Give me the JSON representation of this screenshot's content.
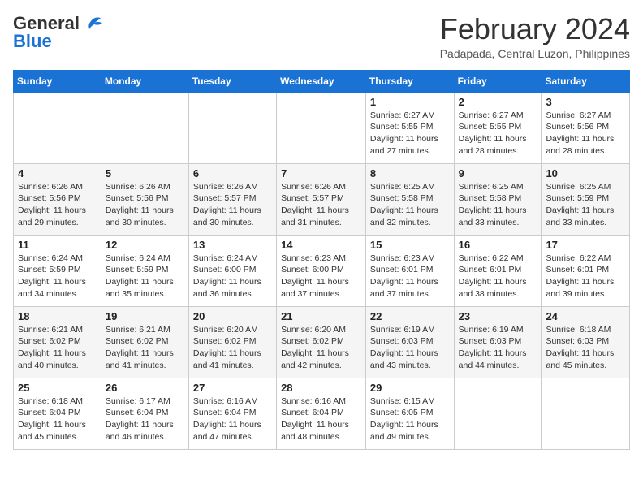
{
  "header": {
    "logo_general": "General",
    "logo_blue": "Blue",
    "month_year": "February 2024",
    "location": "Padapada, Central Luzon, Philippines"
  },
  "calendar": {
    "days_of_week": [
      "Sunday",
      "Monday",
      "Tuesday",
      "Wednesday",
      "Thursday",
      "Friday",
      "Saturday"
    ],
    "weeks": [
      [
        {
          "day": "",
          "info": ""
        },
        {
          "day": "",
          "info": ""
        },
        {
          "day": "",
          "info": ""
        },
        {
          "day": "",
          "info": ""
        },
        {
          "day": "1",
          "info": "Sunrise: 6:27 AM\nSunset: 5:55 PM\nDaylight: 11 hours and 27 minutes."
        },
        {
          "day": "2",
          "info": "Sunrise: 6:27 AM\nSunset: 5:55 PM\nDaylight: 11 hours and 28 minutes."
        },
        {
          "day": "3",
          "info": "Sunrise: 6:27 AM\nSunset: 5:56 PM\nDaylight: 11 hours and 28 minutes."
        }
      ],
      [
        {
          "day": "4",
          "info": "Sunrise: 6:26 AM\nSunset: 5:56 PM\nDaylight: 11 hours and 29 minutes."
        },
        {
          "day": "5",
          "info": "Sunrise: 6:26 AM\nSunset: 5:56 PM\nDaylight: 11 hours and 30 minutes."
        },
        {
          "day": "6",
          "info": "Sunrise: 6:26 AM\nSunset: 5:57 PM\nDaylight: 11 hours and 30 minutes."
        },
        {
          "day": "7",
          "info": "Sunrise: 6:26 AM\nSunset: 5:57 PM\nDaylight: 11 hours and 31 minutes."
        },
        {
          "day": "8",
          "info": "Sunrise: 6:25 AM\nSunset: 5:58 PM\nDaylight: 11 hours and 32 minutes."
        },
        {
          "day": "9",
          "info": "Sunrise: 6:25 AM\nSunset: 5:58 PM\nDaylight: 11 hours and 33 minutes."
        },
        {
          "day": "10",
          "info": "Sunrise: 6:25 AM\nSunset: 5:59 PM\nDaylight: 11 hours and 33 minutes."
        }
      ],
      [
        {
          "day": "11",
          "info": "Sunrise: 6:24 AM\nSunset: 5:59 PM\nDaylight: 11 hours and 34 minutes."
        },
        {
          "day": "12",
          "info": "Sunrise: 6:24 AM\nSunset: 5:59 PM\nDaylight: 11 hours and 35 minutes."
        },
        {
          "day": "13",
          "info": "Sunrise: 6:24 AM\nSunset: 6:00 PM\nDaylight: 11 hours and 36 minutes."
        },
        {
          "day": "14",
          "info": "Sunrise: 6:23 AM\nSunset: 6:00 PM\nDaylight: 11 hours and 37 minutes."
        },
        {
          "day": "15",
          "info": "Sunrise: 6:23 AM\nSunset: 6:01 PM\nDaylight: 11 hours and 37 minutes."
        },
        {
          "day": "16",
          "info": "Sunrise: 6:22 AM\nSunset: 6:01 PM\nDaylight: 11 hours and 38 minutes."
        },
        {
          "day": "17",
          "info": "Sunrise: 6:22 AM\nSunset: 6:01 PM\nDaylight: 11 hours and 39 minutes."
        }
      ],
      [
        {
          "day": "18",
          "info": "Sunrise: 6:21 AM\nSunset: 6:02 PM\nDaylight: 11 hours and 40 minutes."
        },
        {
          "day": "19",
          "info": "Sunrise: 6:21 AM\nSunset: 6:02 PM\nDaylight: 11 hours and 41 minutes."
        },
        {
          "day": "20",
          "info": "Sunrise: 6:20 AM\nSunset: 6:02 PM\nDaylight: 11 hours and 41 minutes."
        },
        {
          "day": "21",
          "info": "Sunrise: 6:20 AM\nSunset: 6:02 PM\nDaylight: 11 hours and 42 minutes."
        },
        {
          "day": "22",
          "info": "Sunrise: 6:19 AM\nSunset: 6:03 PM\nDaylight: 11 hours and 43 minutes."
        },
        {
          "day": "23",
          "info": "Sunrise: 6:19 AM\nSunset: 6:03 PM\nDaylight: 11 hours and 44 minutes."
        },
        {
          "day": "24",
          "info": "Sunrise: 6:18 AM\nSunset: 6:03 PM\nDaylight: 11 hours and 45 minutes."
        }
      ],
      [
        {
          "day": "25",
          "info": "Sunrise: 6:18 AM\nSunset: 6:04 PM\nDaylight: 11 hours and 45 minutes."
        },
        {
          "day": "26",
          "info": "Sunrise: 6:17 AM\nSunset: 6:04 PM\nDaylight: 11 hours and 46 minutes."
        },
        {
          "day": "27",
          "info": "Sunrise: 6:16 AM\nSunset: 6:04 PM\nDaylight: 11 hours and 47 minutes."
        },
        {
          "day": "28",
          "info": "Sunrise: 6:16 AM\nSunset: 6:04 PM\nDaylight: 11 hours and 48 minutes."
        },
        {
          "day": "29",
          "info": "Sunrise: 6:15 AM\nSunset: 6:05 PM\nDaylight: 11 hours and 49 minutes."
        },
        {
          "day": "",
          "info": ""
        },
        {
          "day": "",
          "info": ""
        }
      ]
    ]
  }
}
